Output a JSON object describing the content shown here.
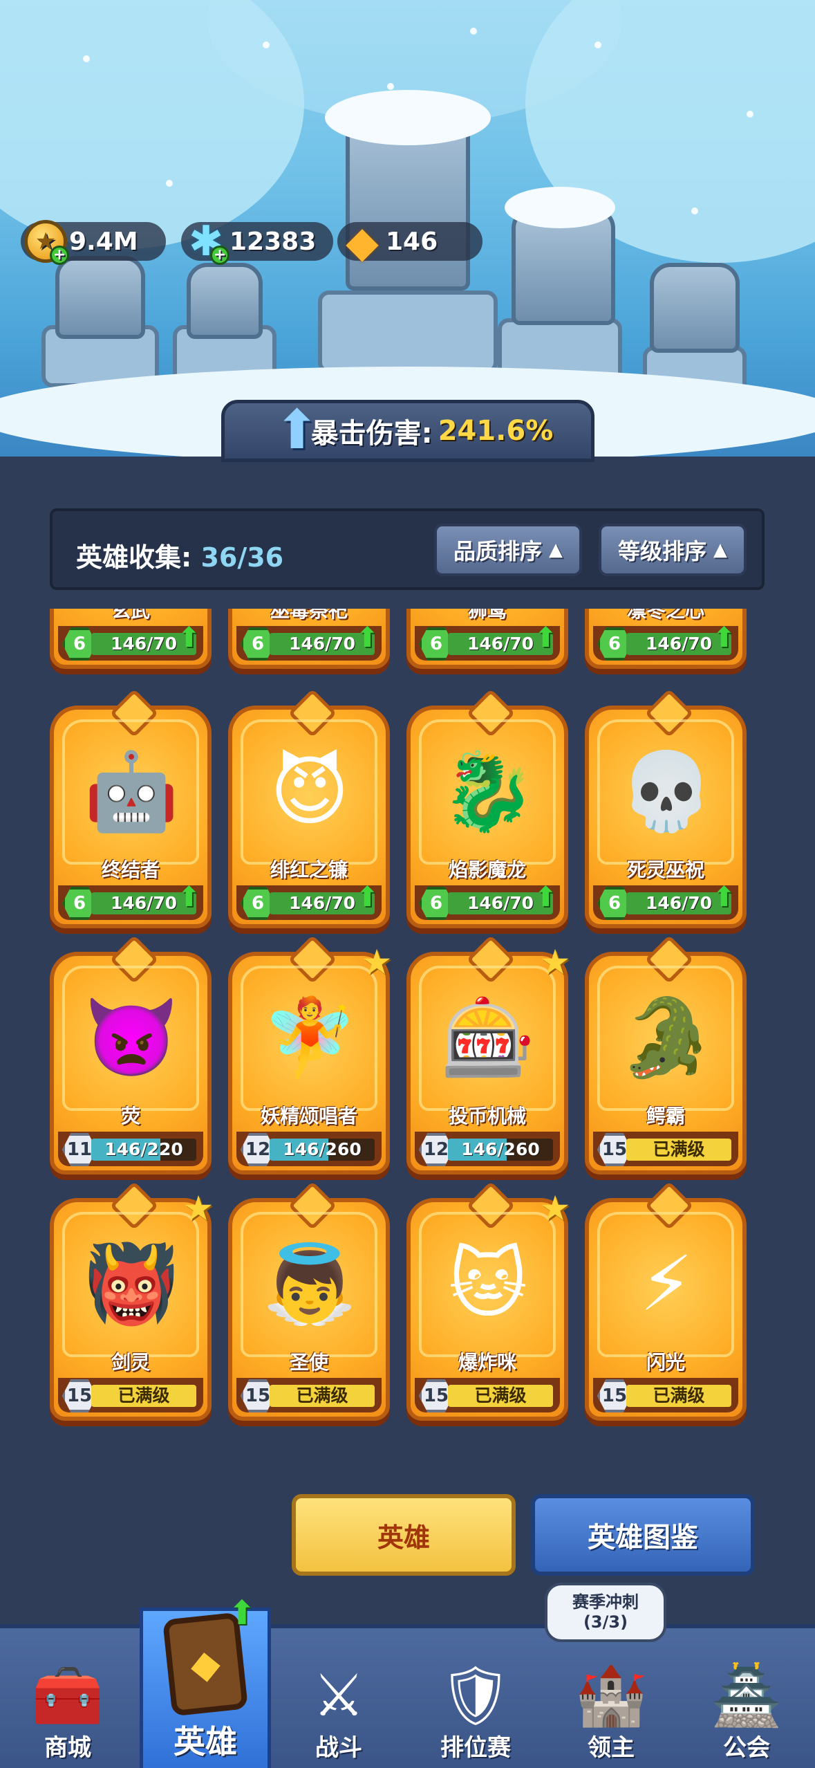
{
  "currency": {
    "gold": "9.4M",
    "gems": "12383",
    "amber": "146"
  },
  "crit": {
    "label": "暴击伤害:",
    "value": "241.6%"
  },
  "collection": {
    "label": "英雄收集:",
    "value": "36/36",
    "sort_quality": "品质排序",
    "sort_level": "等级排序"
  },
  "heroes": [
    {
      "name": "玄武",
      "level": "6",
      "progress": "146/70",
      "fill": 1.0,
      "type": "upgrade"
    },
    {
      "name": "巫毒祭祀",
      "level": "6",
      "progress": "146/70",
      "fill": 1.0,
      "type": "upgrade"
    },
    {
      "name": "狮鹫",
      "level": "6",
      "progress": "146/70",
      "fill": 1.0,
      "type": "upgrade"
    },
    {
      "name": "凛冬之心",
      "level": "6",
      "progress": "146/70",
      "fill": 1.0,
      "type": "upgrade"
    },
    {
      "name": "终结者",
      "level": "6",
      "progress": "146/70",
      "fill": 1.0,
      "type": "upgrade",
      "icon": "🤖"
    },
    {
      "name": "绯红之镰",
      "level": "6",
      "progress": "146/70",
      "fill": 1.0,
      "type": "upgrade",
      "icon": "😈"
    },
    {
      "name": "焰影魔龙",
      "level": "6",
      "progress": "146/70",
      "fill": 1.0,
      "type": "upgrade",
      "icon": "🐉"
    },
    {
      "name": "死灵巫祝",
      "level": "6",
      "progress": "146/70",
      "fill": 1.0,
      "type": "upgrade",
      "icon": "💀"
    },
    {
      "name": "荧",
      "level": "11",
      "progress": "146/220",
      "fill": 0.66,
      "type": "partial",
      "icon": "👿"
    },
    {
      "name": "妖精颂唱者",
      "level": "12",
      "progress": "146/260",
      "fill": 0.56,
      "type": "partial",
      "star": true,
      "icon": "🧚"
    },
    {
      "name": "投币机械",
      "level": "12",
      "progress": "146/260",
      "fill": 0.56,
      "type": "partial",
      "star": true,
      "icon": "🎰"
    },
    {
      "name": "鳄霸",
      "level": "15",
      "progress": "已满级",
      "fill": 1.0,
      "type": "max",
      "icon": "🐊"
    },
    {
      "name": "剑灵",
      "level": "15",
      "progress": "已满级",
      "fill": 1.0,
      "type": "max",
      "star": true,
      "icon": "👹"
    },
    {
      "name": "圣使",
      "level": "15",
      "progress": "已满级",
      "fill": 1.0,
      "type": "max",
      "icon": "👼"
    },
    {
      "name": "爆炸咪",
      "level": "15",
      "progress": "已满级",
      "fill": 1.0,
      "type": "max",
      "star": true,
      "icon": "🐱"
    },
    {
      "name": "闪光",
      "level": "15",
      "progress": "已满级",
      "fill": 1.0,
      "type": "max",
      "icon": "⚡"
    }
  ],
  "actions": {
    "hero": "英雄",
    "codex": "英雄图鉴"
  },
  "season": {
    "title": "赛季冲刺",
    "count": "(3/3)"
  },
  "nav": {
    "shop": "商城",
    "hero": "英雄",
    "battle": "战斗",
    "ranked": "排位赛",
    "lord": "领主",
    "guild": "公会"
  }
}
